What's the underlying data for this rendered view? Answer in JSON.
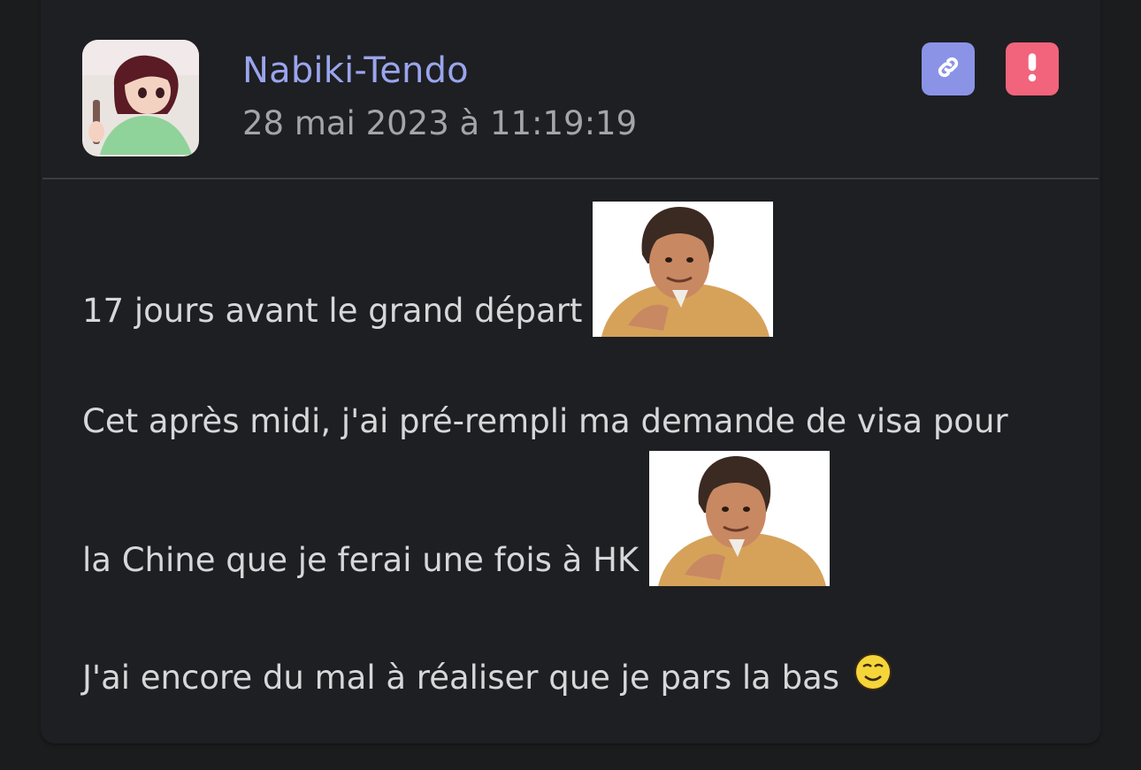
{
  "post": {
    "author": "Nabiki-Tendo",
    "timestamp": "28 mai 2023 à 11:19:19",
    "avatar_icon": "user-avatar",
    "actions": {
      "link_icon": "link-icon",
      "report_icon": "exclamation-icon"
    },
    "lines": [
      {
        "text": "17 jours avant le grand départ",
        "sticker": "reaction-sticker"
      },
      {
        "text": "Cet après midi, j'ai pré-rempli ma demande de visa pour"
      },
      {
        "text": "la Chine que je ferai une fois à HK",
        "sticker": "reaction-sticker"
      },
      {
        "text": "J'ai encore du mal à réaliser que je pars la bas",
        "emoji": "smiley-icon"
      }
    ]
  },
  "colors": {
    "page_background": "#1b1c1e",
    "card_background": "#1e1f22",
    "username": "#9aa5ee",
    "timestamp": "#a3a5a9",
    "body_text": "#d6d7d9",
    "link_button": "#8b93e6",
    "report_button": "#f2647b",
    "divider": "#3a3c40"
  }
}
